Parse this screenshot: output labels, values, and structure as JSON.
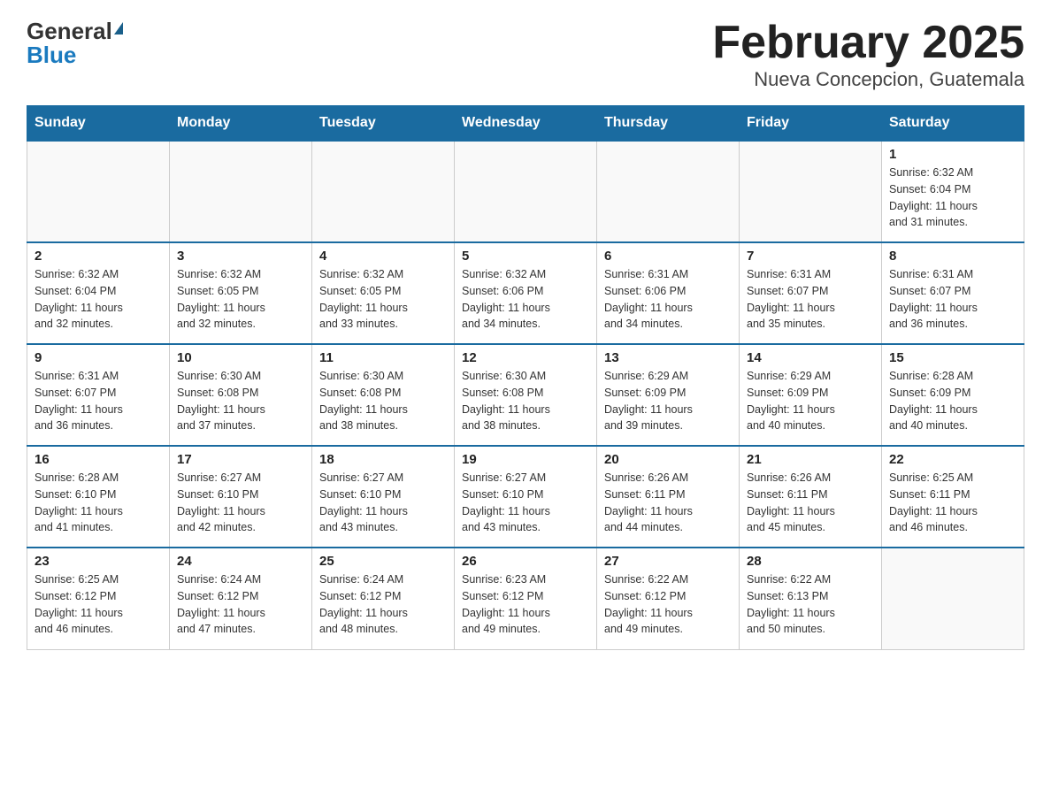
{
  "header": {
    "logo_general": "General",
    "logo_blue": "Blue",
    "title": "February 2025",
    "subtitle": "Nueva Concepcion, Guatemala"
  },
  "weekdays": [
    "Sunday",
    "Monday",
    "Tuesday",
    "Wednesday",
    "Thursday",
    "Friday",
    "Saturday"
  ],
  "weeks": [
    [
      {
        "day": "",
        "info": ""
      },
      {
        "day": "",
        "info": ""
      },
      {
        "day": "",
        "info": ""
      },
      {
        "day": "",
        "info": ""
      },
      {
        "day": "",
        "info": ""
      },
      {
        "day": "",
        "info": ""
      },
      {
        "day": "1",
        "info": "Sunrise: 6:32 AM\nSunset: 6:04 PM\nDaylight: 11 hours\nand 31 minutes."
      }
    ],
    [
      {
        "day": "2",
        "info": "Sunrise: 6:32 AM\nSunset: 6:04 PM\nDaylight: 11 hours\nand 32 minutes."
      },
      {
        "day": "3",
        "info": "Sunrise: 6:32 AM\nSunset: 6:05 PM\nDaylight: 11 hours\nand 32 minutes."
      },
      {
        "day": "4",
        "info": "Sunrise: 6:32 AM\nSunset: 6:05 PM\nDaylight: 11 hours\nand 33 minutes."
      },
      {
        "day": "5",
        "info": "Sunrise: 6:32 AM\nSunset: 6:06 PM\nDaylight: 11 hours\nand 34 minutes."
      },
      {
        "day": "6",
        "info": "Sunrise: 6:31 AM\nSunset: 6:06 PM\nDaylight: 11 hours\nand 34 minutes."
      },
      {
        "day": "7",
        "info": "Sunrise: 6:31 AM\nSunset: 6:07 PM\nDaylight: 11 hours\nand 35 minutes."
      },
      {
        "day": "8",
        "info": "Sunrise: 6:31 AM\nSunset: 6:07 PM\nDaylight: 11 hours\nand 36 minutes."
      }
    ],
    [
      {
        "day": "9",
        "info": "Sunrise: 6:31 AM\nSunset: 6:07 PM\nDaylight: 11 hours\nand 36 minutes."
      },
      {
        "day": "10",
        "info": "Sunrise: 6:30 AM\nSunset: 6:08 PM\nDaylight: 11 hours\nand 37 minutes."
      },
      {
        "day": "11",
        "info": "Sunrise: 6:30 AM\nSunset: 6:08 PM\nDaylight: 11 hours\nand 38 minutes."
      },
      {
        "day": "12",
        "info": "Sunrise: 6:30 AM\nSunset: 6:08 PM\nDaylight: 11 hours\nand 38 minutes."
      },
      {
        "day": "13",
        "info": "Sunrise: 6:29 AM\nSunset: 6:09 PM\nDaylight: 11 hours\nand 39 minutes."
      },
      {
        "day": "14",
        "info": "Sunrise: 6:29 AM\nSunset: 6:09 PM\nDaylight: 11 hours\nand 40 minutes."
      },
      {
        "day": "15",
        "info": "Sunrise: 6:28 AM\nSunset: 6:09 PM\nDaylight: 11 hours\nand 40 minutes."
      }
    ],
    [
      {
        "day": "16",
        "info": "Sunrise: 6:28 AM\nSunset: 6:10 PM\nDaylight: 11 hours\nand 41 minutes."
      },
      {
        "day": "17",
        "info": "Sunrise: 6:27 AM\nSunset: 6:10 PM\nDaylight: 11 hours\nand 42 minutes."
      },
      {
        "day": "18",
        "info": "Sunrise: 6:27 AM\nSunset: 6:10 PM\nDaylight: 11 hours\nand 43 minutes."
      },
      {
        "day": "19",
        "info": "Sunrise: 6:27 AM\nSunset: 6:10 PM\nDaylight: 11 hours\nand 43 minutes."
      },
      {
        "day": "20",
        "info": "Sunrise: 6:26 AM\nSunset: 6:11 PM\nDaylight: 11 hours\nand 44 minutes."
      },
      {
        "day": "21",
        "info": "Sunrise: 6:26 AM\nSunset: 6:11 PM\nDaylight: 11 hours\nand 45 minutes."
      },
      {
        "day": "22",
        "info": "Sunrise: 6:25 AM\nSunset: 6:11 PM\nDaylight: 11 hours\nand 46 minutes."
      }
    ],
    [
      {
        "day": "23",
        "info": "Sunrise: 6:25 AM\nSunset: 6:12 PM\nDaylight: 11 hours\nand 46 minutes."
      },
      {
        "day": "24",
        "info": "Sunrise: 6:24 AM\nSunset: 6:12 PM\nDaylight: 11 hours\nand 47 minutes."
      },
      {
        "day": "25",
        "info": "Sunrise: 6:24 AM\nSunset: 6:12 PM\nDaylight: 11 hours\nand 48 minutes."
      },
      {
        "day": "26",
        "info": "Sunrise: 6:23 AM\nSunset: 6:12 PM\nDaylight: 11 hours\nand 49 minutes."
      },
      {
        "day": "27",
        "info": "Sunrise: 6:22 AM\nSunset: 6:12 PM\nDaylight: 11 hours\nand 49 minutes."
      },
      {
        "day": "28",
        "info": "Sunrise: 6:22 AM\nSunset: 6:13 PM\nDaylight: 11 hours\nand 50 minutes."
      },
      {
        "day": "",
        "info": ""
      }
    ]
  ]
}
